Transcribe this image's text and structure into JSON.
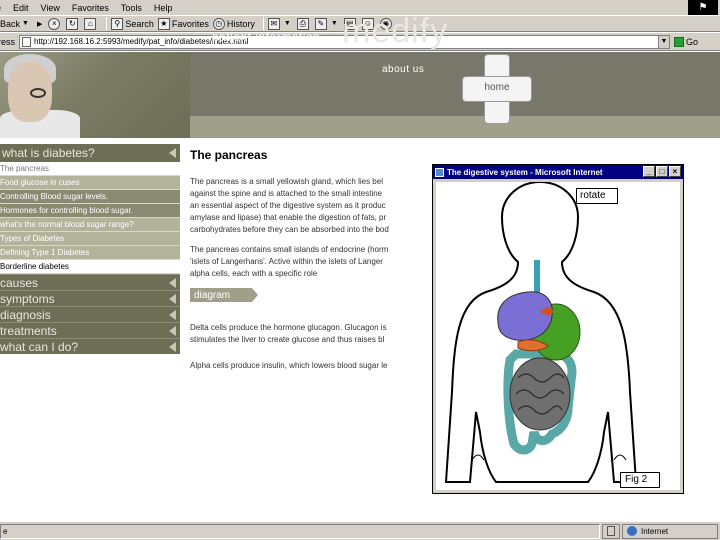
{
  "browser": {
    "menu": [
      "e",
      "Edit",
      "View",
      "Favorites",
      "Tools",
      "Help"
    ],
    "toolbar": {
      "back": "Back",
      "search": "Search",
      "favorites": "Favorites",
      "history": "History"
    },
    "address_label": "ress",
    "address_url": "http://192.168.16.2:5993/medify/pat_info/diabetes/index.html",
    "go": "Go",
    "status_left": "e",
    "status_zone": "Internet"
  },
  "header": {
    "patient_info": "patient information",
    "brand": "medify",
    "home": "home",
    "about": "about us"
  },
  "sidebar": {
    "section_title": "what is diabetes?",
    "items": [
      "The pancreas",
      "Food glucose in cuses",
      "Controlling Blood sugar levels.",
      "Hormones for controlling blood sugar.",
      "what's the normal blood sugar range?",
      "Types of Diabetes",
      "Defining Type 1 Diabetes",
      "Borderline diabetes"
    ],
    "categories": [
      "causes",
      "symptoms",
      "diagnosis",
      "treatments",
      "what can I do?"
    ]
  },
  "content": {
    "title": "The pancreas",
    "para1": [
      "The pancreas is a small yellowish gland, which lies bel",
      "against the spine and is attached to the small intestine",
      "an essential aspect of the digestive system as it produc",
      "amylase and lipase) that enable the digestion of fats, pr",
      "carbohydrates before they can be absorbed into the bod"
    ],
    "para2": [
      "The pancreas contains small islands of endocrine (horm",
      "'islets of Langerhans'. Active within the islets of Langer",
      "alpha cells, each with a specific role"
    ],
    "diagram_button": "diagram",
    "para3": [
      "Delta cells produce the hormone glucagon. Glucagon is",
      "stimulates the liver to create glucose and thus raises bl"
    ],
    "para4": [
      "Alpha cells produce insulin, which lowers blood sugar le"
    ]
  },
  "popup": {
    "title": "The digestive system - Microsoft Internet",
    "rotate": "rotate",
    "fig": "Fig 2",
    "colors": {
      "stomach": "#7b6fd6",
      "liver": "#46a024",
      "intestine": "#6f6f6f",
      "colon": "#5aa7a7",
      "esophagus": "#3aa0b8"
    }
  }
}
